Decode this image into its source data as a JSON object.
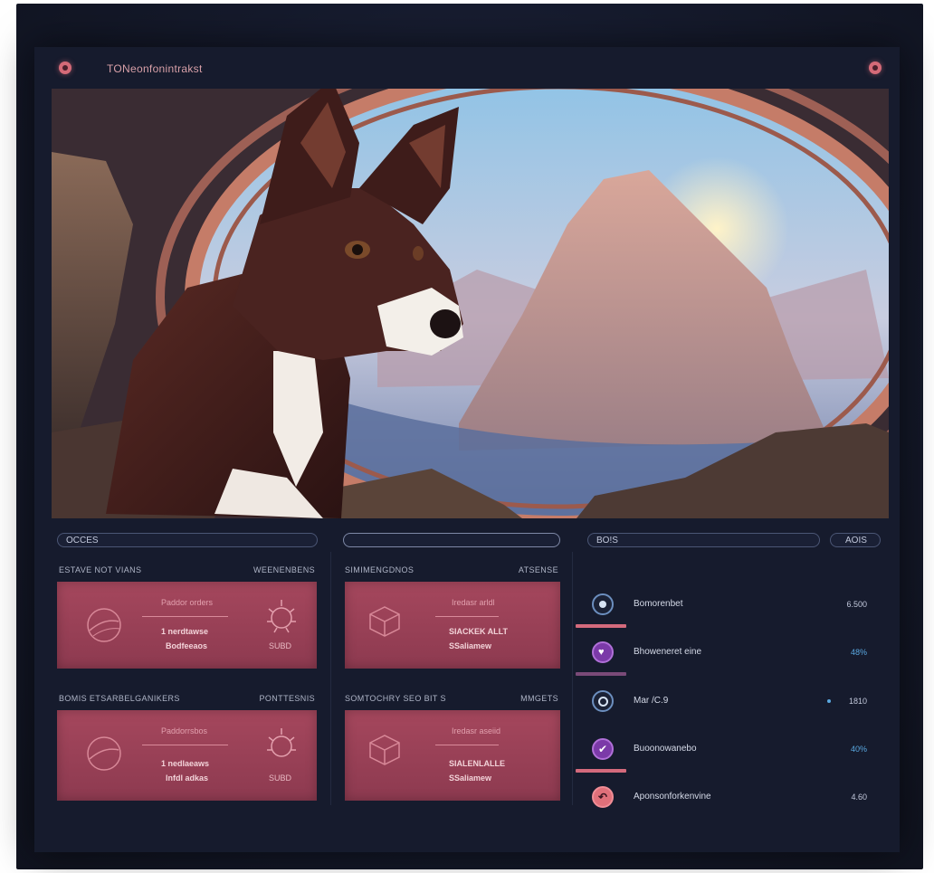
{
  "window": {
    "title": "TONeonfonintrakst"
  },
  "search": {
    "left_value": "OCCES",
    "center_value": "",
    "right_value": "BO!S",
    "right_button": "AOIS"
  },
  "cards": [
    {
      "header_left": "ESTAVE NOT VIANS",
      "header_right": "WEENENBENS",
      "line1": "Paddor orders",
      "line2": "1 nerdtawse",
      "line3": "Bodfeeaos",
      "value": "SUBD"
    },
    {
      "header_left": "SIMIMENGDNOS",
      "header_right": "ATSENSE",
      "line1": "Iredasr arldl",
      "line2": "SIACKEK ALLT",
      "line3": "SSaliamew",
      "value": ""
    },
    {
      "header_left": "BOMIS ETSARBELGANIKERS",
      "header_right": "PONTTESNIS",
      "line1": "Paddorrsbos",
      "line2": "1 nedlaeaws",
      "line3": "lnfdl adkas",
      "value": "SUBD"
    },
    {
      "header_left": "SOMTOCHRY SEO BIT S",
      "header_right": "MMGETS",
      "line1": "Iredasr aseiid",
      "line2": "SIALENLALLE",
      "line3": "SSaliamew",
      "value": ""
    }
  ],
  "list": [
    {
      "label": "Bomorenbet",
      "value": "6.500",
      "icon": "target-icon",
      "value_color": "plain"
    },
    {
      "label": "Bhoweneret eine",
      "value": "48%",
      "icon": "heart-icon",
      "value_color": "blue"
    },
    {
      "label": "Mar /C.9",
      "value": "1810",
      "icon": "target-icon",
      "value_color": "plain"
    },
    {
      "label": "Buoonowanebo",
      "value": "40%",
      "icon": "check-icon",
      "value_color": "blue"
    },
    {
      "label": "Aponsonforkenvine",
      "value": "4.60",
      "icon": "arrow-icon",
      "value_color": "plain"
    }
  ],
  "colors": {
    "accent": "#d46a7c",
    "card": "#a5475d",
    "background": "#161b2d",
    "value_blue": "#5aa8e0"
  }
}
